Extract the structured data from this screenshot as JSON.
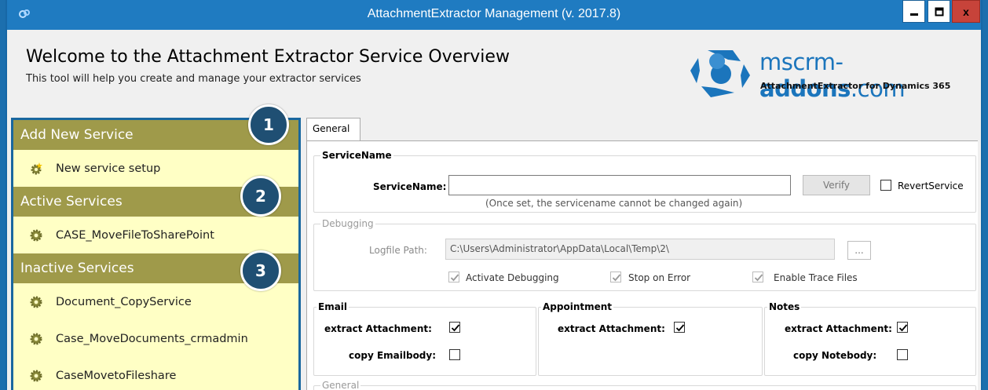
{
  "window": {
    "title": "AttachmentExtractor Management (v. 2017.8)",
    "min_glyph": "▁",
    "max_glyph": "▢",
    "close_glyph": "x"
  },
  "header": {
    "title": "Welcome to the Attachment Extractor Service Overview",
    "subtitle": "This tool will help you create and manage your extractor services",
    "brand_name_prefix": "mscrm-",
    "brand_name_bold": "addons",
    "brand_name_suffix": ".com",
    "brand_sub": "AttachmentExtractor for Dynamics 365"
  },
  "sidebar": {
    "add_section": "Add New Service",
    "new_service": "New service setup",
    "active_section": "Active Services",
    "active_items": [
      "CASE_MoveFileToSharePoint"
    ],
    "inactive_section": "Inactive Services",
    "inactive_items": [
      "Document_CopyService",
      "Case_MoveDocuments_crmadmin",
      "CaseMovetoFileshare"
    ],
    "badges": [
      "1",
      "2",
      "3"
    ]
  },
  "tabs": {
    "general": "General"
  },
  "servicename": {
    "group": "ServiceName",
    "label": "ServiceName:",
    "value": "",
    "verify": "Verify",
    "revert": "RevertService",
    "revert_checked": false,
    "hint": "(Once set, the servicename cannot be changed again)"
  },
  "debugging": {
    "group": "Debugging",
    "logfile_label": "Logfile Path:",
    "logfile_value": "C:\\Users\\Administrator\\AppData\\Local\\Temp\\2\\",
    "browse": "...",
    "activate": "Activate Debugging",
    "stop": "Stop on Error",
    "trace": "Enable Trace Files"
  },
  "email": {
    "group": "Email",
    "extract": "extract Attachment:",
    "extract_checked": true,
    "copy": "copy Emailbody:",
    "copy_checked": false
  },
  "appointment": {
    "group": "Appointment",
    "extract": "extract Attachment:",
    "extract_checked": true
  },
  "notes": {
    "group": "Notes",
    "extract": "extract Attachment:",
    "extract_checked": true,
    "copy": "copy Notebody:",
    "copy_checked": false
  },
  "general_group": "General",
  "colors": {
    "titlebar": "#1f7bc1",
    "section": "#9f9a4a",
    "panel": "#ffffc5",
    "badge": "#1f4f73",
    "brand": "#1b75bc"
  }
}
